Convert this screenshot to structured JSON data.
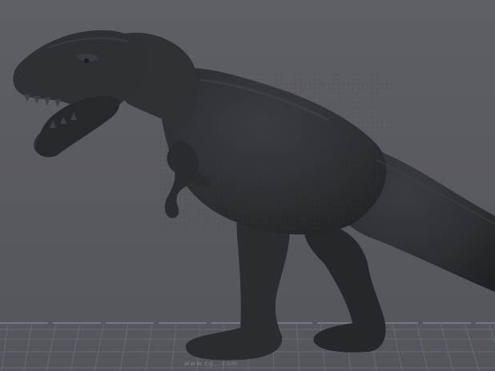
{
  "viewport": {
    "background_color": "#5b5c61",
    "model_color": "#2e2f33",
    "grid_color": "#6f7a8a",
    "model_name": "t-rex-icon",
    "watermark": "www.cg...com"
  }
}
